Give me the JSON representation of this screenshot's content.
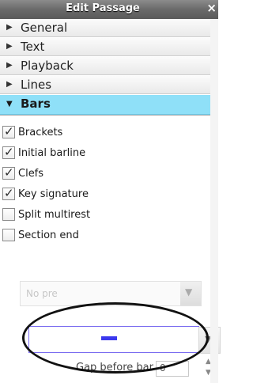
{
  "window": {
    "title": "Edit Passage",
    "close_glyph": "×"
  },
  "sections": [
    {
      "label": "General",
      "expanded": false
    },
    {
      "label": "Text",
      "expanded": false
    },
    {
      "label": "Playback",
      "expanded": false
    },
    {
      "label": "Lines",
      "expanded": false
    },
    {
      "label": "Bars",
      "expanded": true
    }
  ],
  "bars": {
    "options": [
      {
        "label": "Brackets",
        "checked": true
      },
      {
        "label": "Initial barline",
        "checked": true
      },
      {
        "label": "Clefs",
        "checked": true
      },
      {
        "label": "Key signature",
        "checked": true
      },
      {
        "label": "Split multirest",
        "checked": false
      },
      {
        "label": "Section end",
        "checked": false
      }
    ],
    "preset_select": {
      "value": "No pre"
    },
    "barline_select": {
      "selected_swatch_color": "#3b38ee"
    },
    "gap_before_bar": {
      "label": "Gap before bar",
      "value": "0"
    }
  },
  "icons": {
    "collapsed": "triangle-right-icon",
    "expanded": "triangle-down-icon",
    "checkbox_tick": "checkmark-icon",
    "dropdown": "chevron-down-icon",
    "spinner_up": "chevron-up-icon",
    "spinner_down": "chevron-down-icon"
  }
}
